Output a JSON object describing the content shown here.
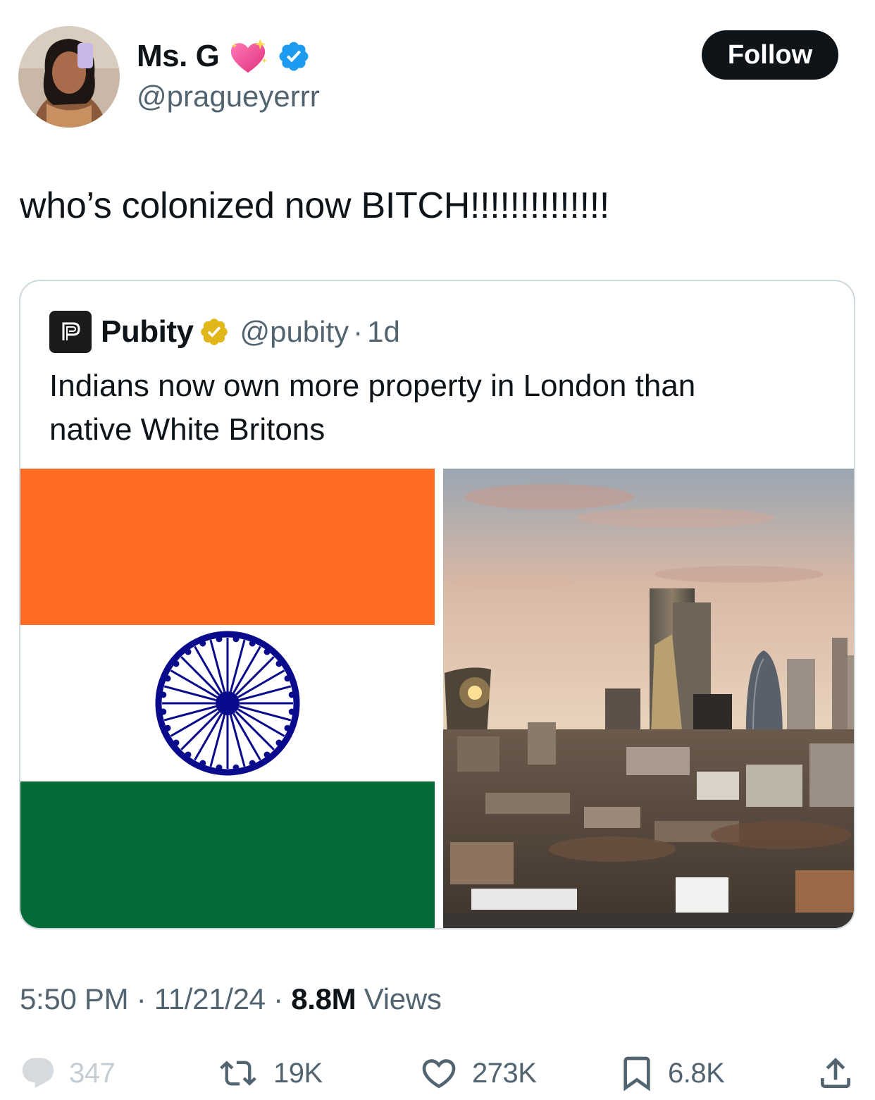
{
  "author": {
    "name": "Ms. G",
    "handle": "@pragueyerrr",
    "follow_label": "Follow",
    "avatar_icon": "profile-photo",
    "name_emoji": "sparkling-heart-icon",
    "verified_color": "#1d9bf0"
  },
  "tweet": {
    "text": "who’s colonized now BITCH!!!!!!!!!!!!!!"
  },
  "quote": {
    "logo_letter": "P",
    "name": "Pubity",
    "handle": "@pubity",
    "separator": "·",
    "time": "1d",
    "text_line1": "Indians now own more property in London than",
    "text_line2": "native White Britons",
    "badge_color": "#e2b719",
    "media": {
      "left": "india-flag-image",
      "right": "london-skyline-photo",
      "flag_colors": {
        "saffron": "#ff6b22",
        "white": "#ffffff",
        "green": "#066b36",
        "chakra": "#0a0a8c"
      }
    }
  },
  "meta": {
    "time": "5:50 PM",
    "sep1": "·",
    "date": "11/21/24",
    "sep2": "·",
    "views_count": "8.8M",
    "views_label": "Views"
  },
  "actions": {
    "replies": "347",
    "reposts": "19K",
    "likes": "273K",
    "bookmarks": "6.8K"
  }
}
